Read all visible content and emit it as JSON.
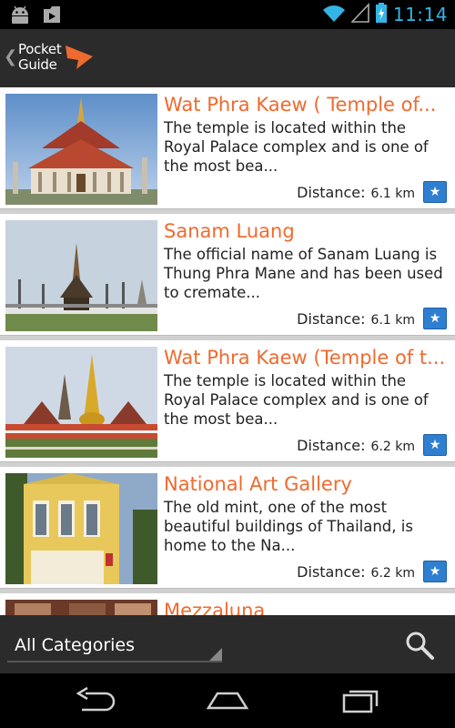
{
  "status_bar": {
    "time": "11:14",
    "icons": [
      "android-icon",
      "download-icon",
      "wifi-icon",
      "signal-icon",
      "battery-charging-icon"
    ]
  },
  "action_bar": {
    "logo_word1": "Pocket",
    "logo_word2": "Guide",
    "accent": "#ef6a2e"
  },
  "places": [
    {
      "title": "Wat Phra Kaew  ( Temple of...",
      "description": "The temple is located within the Royal Palace complex and is one of the most bea...",
      "distance_label": "Distance:",
      "distance": "6.1 km"
    },
    {
      "title": "Sanam Luang",
      "description": "The official name of Sanam Luang is Thung Phra Mane and has been used to cremate...",
      "distance_label": "Distance:",
      "distance": "6.1 km"
    },
    {
      "title": "Wat Phra Kaew (Temple of t...",
      "description": "The temple is located within the Royal Palace complex and is one of the most bea...",
      "distance_label": "Distance:",
      "distance": "6.2 km"
    },
    {
      "title": "National Art Gallery",
      "description": "The old mint, one of the most beautiful buildings of Thailand, is home to the Na...",
      "distance_label": "Distance:",
      "distance": "6.2 km"
    },
    {
      "title": "Mezzaluna",
      "description": "",
      "distance_label": "",
      "distance": ""
    }
  ],
  "category_bar": {
    "selected": "All Categories"
  },
  "colors": {
    "title": "#ef6a2e",
    "status_time": "#33b5e5",
    "favorite": "#2f7fd1"
  }
}
